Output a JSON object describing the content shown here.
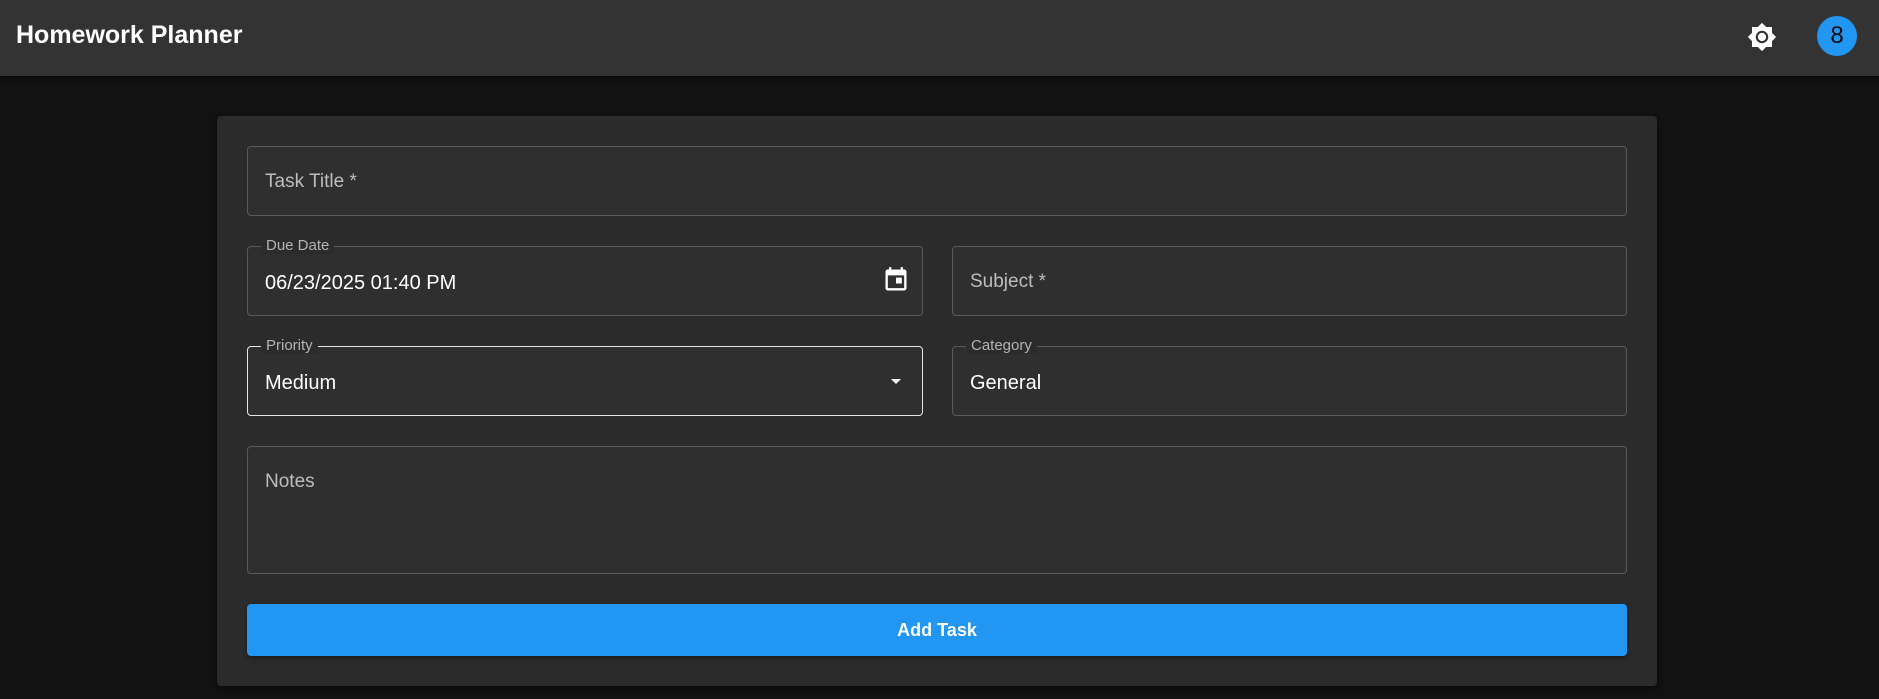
{
  "app": {
    "title": "Homework Planner",
    "user_avatar_letter": "8",
    "theme_icon": "brightness-icon"
  },
  "form": {
    "task_title": {
      "placeholder": "Task Title *",
      "value": ""
    },
    "due_date": {
      "label": "Due Date",
      "value": "06/23/2025 01:40 PM",
      "icon": "calendar-icon"
    },
    "subject": {
      "placeholder": "Subject *",
      "value": ""
    },
    "priority": {
      "label": "Priority",
      "value": "Medium",
      "icon": "dropdown-arrow-icon"
    },
    "category": {
      "label": "Category",
      "value": "General"
    },
    "notes": {
      "placeholder": "Notes",
      "value": ""
    },
    "submit_label": "Add Task"
  },
  "colors": {
    "background": "#121212",
    "appbar": "#333333",
    "card": "#2b2b2b",
    "accent": "#2196f3"
  }
}
